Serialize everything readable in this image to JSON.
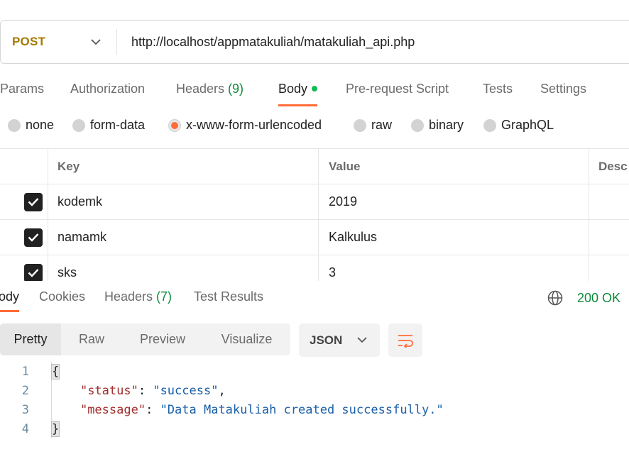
{
  "request": {
    "method": "POST",
    "url": "http://localhost/appmatakuliah/matakuliah_api.php"
  },
  "request_tabs": [
    {
      "label": "Params"
    },
    {
      "label": "Authorization"
    },
    {
      "label": "Headers ",
      "count": "(9)"
    },
    {
      "label": "Body"
    },
    {
      "label": "Pre-request Script"
    },
    {
      "label": "Tests"
    },
    {
      "label": "Settings"
    }
  ],
  "active_request_tab": "Body",
  "body_types": [
    "none",
    "form-data",
    "x-www-form-urlencoded",
    "raw",
    "binary",
    "GraphQL"
  ],
  "selected_body_type": "x-www-form-urlencoded",
  "params_table": {
    "headers": {
      "key": "Key",
      "value": "Value",
      "description": "Desc"
    },
    "rows": [
      {
        "checked": true,
        "key": "kodemk",
        "value": "2019"
      },
      {
        "checked": true,
        "key": "namamk",
        "value": "Kalkulus"
      },
      {
        "checked": true,
        "key": "sks",
        "value": "3"
      }
    ]
  },
  "response_tabs": [
    {
      "label": "ody"
    },
    {
      "label": "Cookies"
    },
    {
      "label": "Headers ",
      "count": "(7)"
    },
    {
      "label": "Test Results"
    }
  ],
  "response_status": "200 OK",
  "view_modes": [
    "Pretty",
    "Raw",
    "Preview",
    "Visualize"
  ],
  "active_view_mode": "Pretty",
  "format": "JSON",
  "code": {
    "line_numbers": [
      "1",
      "2",
      "3",
      "4"
    ],
    "open_brace": "{",
    "close_brace": "}",
    "status_key": "\"status\"",
    "status_value": "\"success\"",
    "message_key": "\"message\"",
    "message_value": "\"Data Matakuliah created successfully.\""
  },
  "colors": {
    "method": "#a87800",
    "accent": "#ff6c37",
    "success": "#0d8a3c",
    "json_key": "#a12e2e",
    "json_string": "#1a5fa8"
  },
  "icons": [
    "chevron-down-icon",
    "checkmark-icon",
    "globe-icon",
    "wrap-lines-icon"
  ]
}
